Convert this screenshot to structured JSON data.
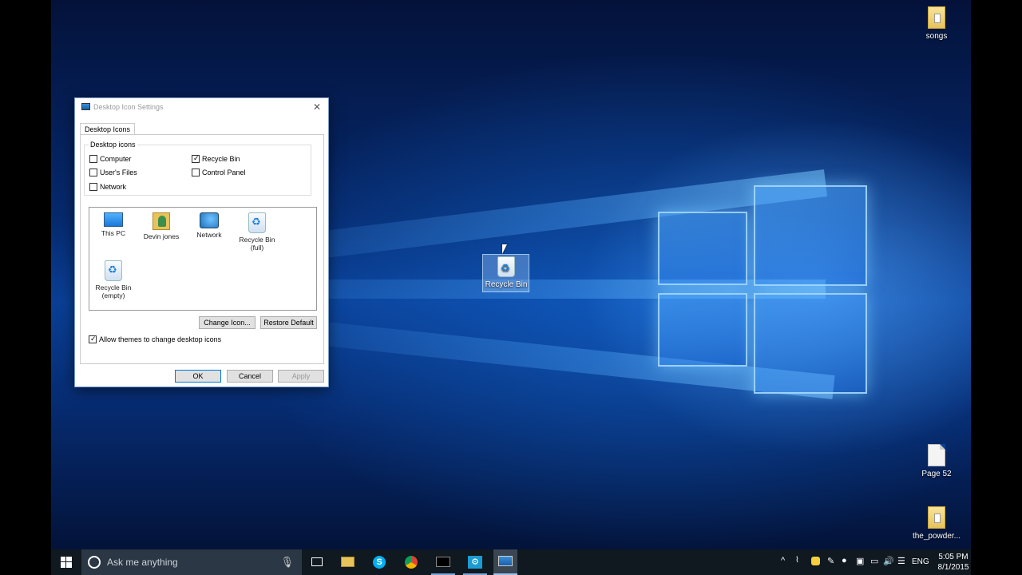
{
  "desktop": {
    "icons": [
      {
        "label": "songs",
        "icon": "folder-icon"
      },
      {
        "label": "Recycle Bin",
        "icon": "recycle-bin-icon"
      },
      {
        "label": "Page 52",
        "icon": "document-icon"
      },
      {
        "label": "the_powder...",
        "icon": "folder-icon"
      }
    ]
  },
  "dialog": {
    "title": "Desktop Icon Settings",
    "close": "✕",
    "tab": "Desktop Icons",
    "group_label": "Desktop icons",
    "checkboxes": [
      {
        "label": "Computer",
        "checked": false
      },
      {
        "label": "Recycle Bin",
        "checked": true
      },
      {
        "label": "User's Files",
        "checked": false
      },
      {
        "label": "Control Panel",
        "checked": false
      },
      {
        "label": "Network",
        "checked": false
      }
    ],
    "icons": [
      {
        "label": "This PC",
        "icon": "monitor-icon"
      },
      {
        "label": "Devin jones",
        "icon": "user-folder-icon"
      },
      {
        "label": "Network",
        "icon": "network-icon"
      },
      {
        "label": "Recycle Bin (full)",
        "icon": "recycle-bin-full-icon"
      },
      {
        "label": "Recycle Bin (empty)",
        "icon": "recycle-bin-empty-icon"
      }
    ],
    "change_icon": "Change Icon...",
    "restore_default": "Restore Default",
    "allow_themes": {
      "label": "Allow themes to change desktop icons",
      "checked": true
    },
    "ok": "OK",
    "cancel": "Cancel",
    "apply": "Apply"
  },
  "taskbar": {
    "search_placeholder": "Ask me anything",
    "language": "ENG",
    "time": "5:05 PM",
    "date": "8/1/2015",
    "accent": "#0078d7"
  }
}
